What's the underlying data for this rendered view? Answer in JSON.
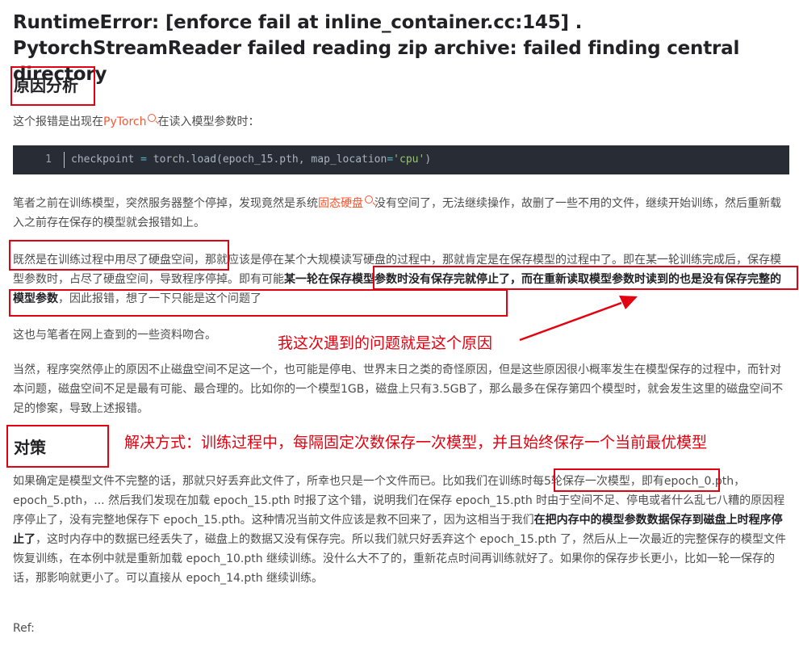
{
  "title": "RuntimeError: [enforce fail at inline_container.cc:145] . PytorchStreamReader failed reading zip archive: failed finding central directory",
  "section1": {
    "heading": "原因分析"
  },
  "intro": {
    "before": "这个报错是出现在",
    "link": "PyTorch",
    "after": "在读入模型参数时："
  },
  "code": {
    "line_no": "1",
    "before": "checkpoint ",
    "eq": "=",
    "mid": " torch.load(epoch_15.pth, map_location",
    "eq2": "=",
    "str": "'cpu'",
    "end": ")"
  },
  "para1": {
    "before": "笔者之前在训练模型，突然服务器整个停掉，发现竟然是系统",
    "link": "固态硬盘",
    "after": "没有空间了，无法继续操作，故删了一些不用的文件，继续开始训练，然后重新载入之前存在保存的模型就会报错如上。"
  },
  "para2": {
    "part1": "既然是在训练过程中用尽了硬盘空间，那就应该是停在某个大规模读写硬盘的过程中，那就肯定是在保存模型的过程中了。即在某一轮训练完成后，保存模型参数时，占尽了硬盘空间，导致程序停掉。即有可能",
    "bold": "某一轮在保存模型参数时没有保存完就停止了，而在重新读取模型参数时读到的也是没有保存完整的模型参数",
    "part2": "，因此报错，想了一下只能是这个问题了"
  },
  "para3": {
    "text": "这也与笔者在网上查到的一些资料吻合。"
  },
  "annotation1": "我这次遇到的问题就是这个原因",
  "para4": {
    "text": "当然，程序突然停止的原因不止磁盘空间不足这一个，也可能是停电、世界末日之类的奇怪原因，但是这些原因很小概率发生在模型保存的过程中，而针对本问题，磁盘空间不足是最有可能、最合理的。比如你的一个模型1GB，磁盘上只有3.5GB了，那么最多在保存第四个模型时，就会发生这里的磁盘空间不足的惨案，导致上述报错。"
  },
  "section2": {
    "heading": "对策"
  },
  "annotation2": "解决方式：训练过程中，每隔固定次数保存一次模型，并且始终保存一个当前最优模型",
  "para5": {
    "part1": "如果确定是模型文件不完整的话，那就只好丢弃此文件了，所幸也只是一个文件而已。比如我们在训练时每5轮保存一次模型，即有epoch_0.pth，epoch_5.pth，... 然后我们发现在加载 epoch_15.pth 时报了这个错，说明我们在保存 epoch_15.pth 时由于空间不足、停电或者什么乱七八糟的原因程序停止了，没有完整地保存下 epoch_15.pth。这种情况当前文件应该是救不回来了，因为这相当于我们",
    "bold": "在把内存中的模型参数数据保存到磁盘上时程序停止了",
    "part2": "，这时内存中的数据已经丢失了，磁盘上的数据又没有保存完。所以我们就只好丢弃这个 epoch_15.pth 了，然后从上一次最近的完整保存的模型文件恢复训练，在本例中就是重新加载 epoch_10.pth 继续训练。没什么大不了的，重新花点时间再训练就好了。如果你的保存步长更小，比如一轮一保存的话，那影响就更小了。可以直接从 epoch_14.pth 继续训练。"
  },
  "ref": "Ref:",
  "colors": {
    "link": "#fc5531",
    "annotation": "#e3000f",
    "code_bg": "#282c34"
  }
}
